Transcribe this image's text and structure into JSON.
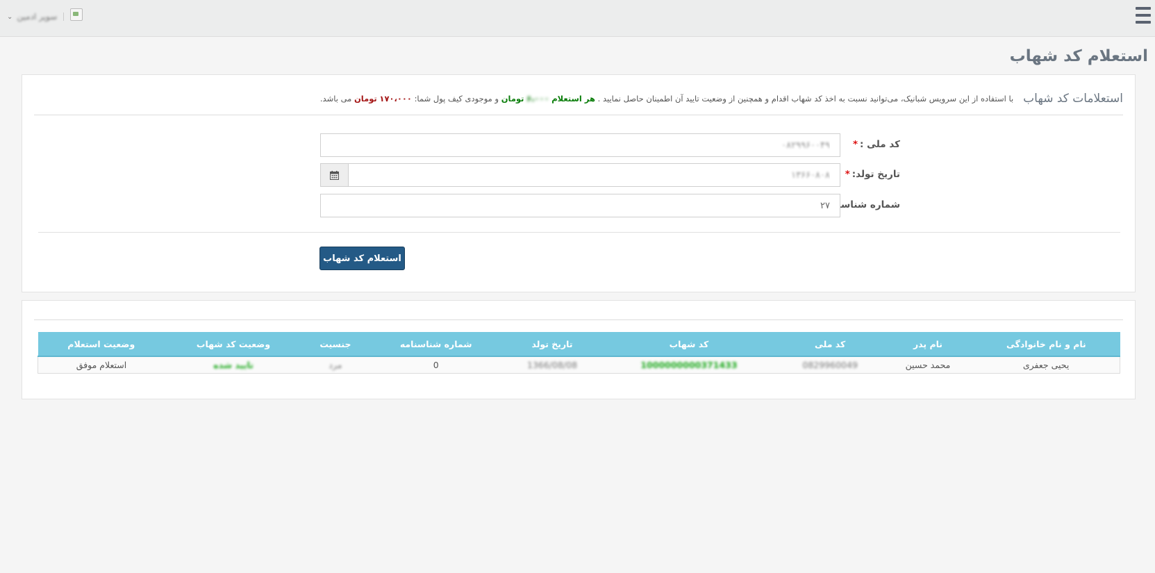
{
  "header": {
    "username": "سوپر ادمین",
    "menu_icon": "hamburger-icon"
  },
  "page": {
    "title": "استعلام کد شهاب"
  },
  "panel": {
    "title": "استعلامات کد شهاب",
    "desc_intro": "با استفاده از این سرویس شبانیک، می‌توانید نسبت به اخذ کد شهاب اقدام و همچنین از وضعیت تایید آن اطمینان حاصل نمایید .",
    "desc_per_query_label": "هر استعلام",
    "desc_per_query_amount": "۶،۰۰۰",
    "desc_per_query_unit": "تومان",
    "desc_wallet_prefix": "و موجودی کیف پول شما:",
    "desc_wallet_amount": "۱۷۰،۰۰۰",
    "desc_wallet_unit": "تومان",
    "desc_suffix": "می باشد."
  },
  "form": {
    "national_code": {
      "label": "کد ملی :",
      "required_mark": "*",
      "value": "۰۸۲۹۹۶۰۰۴۹"
    },
    "birth_date": {
      "label": "تاریخ تولد:",
      "required_mark": "*",
      "value": "۱۳۶۶۰۸۰۸"
    },
    "id_number": {
      "label": "شماره شناسنامه :",
      "value": "۲۷"
    },
    "submit_label": "استعلام کد شهاب"
  },
  "results": {
    "columns": [
      "نام و نام خانوادگی",
      "نام پدر",
      "کد ملی",
      "کد شهاب",
      "تاریخ تولد",
      "شماره شناسنامه",
      "جنسیت",
      "وضعیت کد شهاب",
      "وضعیت استعلام"
    ],
    "rows": [
      {
        "full_name": "یحیی جعفری",
        "father_name": "محمد حسین",
        "national_code": "0829960049",
        "shahab_code": "1000000000371433",
        "birth_date": "1366/08/08",
        "id_number": "0",
        "gender": "مرد",
        "shahab_status": "تایید شده",
        "query_status": "استعلام موفق"
      }
    ]
  },
  "colors": {
    "accent_button": "#245a86",
    "table_header": "#76c9e0",
    "green_text": "#0a7d0a",
    "red_text": "#a41515"
  }
}
